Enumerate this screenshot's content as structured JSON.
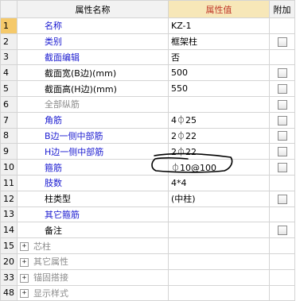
{
  "header": {
    "name_col": "属性名称",
    "value_col": "属性值",
    "extra_col": "附加"
  },
  "rows": [
    {
      "num": "1",
      "name": "名称",
      "value": "KZ-1",
      "style": "blue",
      "checkbox": false
    },
    {
      "num": "2",
      "name": "类别",
      "value": "框架柱",
      "style": "blue",
      "checkbox": true
    },
    {
      "num": "3",
      "name": "截面编辑",
      "value": "否",
      "style": "blue",
      "checkbox": false
    },
    {
      "num": "4",
      "name": "截面宽(B边)(mm)",
      "value": "500",
      "style": "black",
      "checkbox": true
    },
    {
      "num": "5",
      "name": "截面高(H边)(mm)",
      "value": "550",
      "style": "black",
      "checkbox": true
    },
    {
      "num": "6",
      "name": "全部纵筋",
      "value": "",
      "style": "gray",
      "checkbox": true
    },
    {
      "num": "7",
      "name": "角筋",
      "value": "4⏀25",
      "style": "blue",
      "checkbox": true
    },
    {
      "num": "8",
      "name": "B边一侧中部筋",
      "value": "2⏀22",
      "style": "blue",
      "checkbox": true
    },
    {
      "num": "9",
      "name": "H边一侧中部筋",
      "value": "2⏀22",
      "style": "blue",
      "checkbox": true
    },
    {
      "num": "10",
      "name": "箍筋",
      "value": "⏀10@100",
      "style": "blue",
      "checkbox": true
    },
    {
      "num": "11",
      "name": "肢数",
      "value": "4*4",
      "style": "blue",
      "checkbox": false
    },
    {
      "num": "12",
      "name": "柱类型",
      "value": "(中柱)",
      "style": "black",
      "checkbox": true
    },
    {
      "num": "13",
      "name": "其它箍筋",
      "value": "",
      "style": "blue",
      "checkbox": false
    },
    {
      "num": "14",
      "name": "备注",
      "value": "",
      "style": "black",
      "checkbox": true
    }
  ],
  "groups": [
    {
      "num": "15",
      "name": "芯柱"
    },
    {
      "num": "20",
      "name": "其它属性"
    },
    {
      "num": "33",
      "name": "锚固搭接"
    },
    {
      "num": "48",
      "name": "显示样式"
    }
  ],
  "colors": {
    "selected_row_number": "#f5c96a",
    "value_header": "#f7e7b8",
    "blue_label": "#1a1ad0",
    "gray_label": "#8c8c8c"
  }
}
